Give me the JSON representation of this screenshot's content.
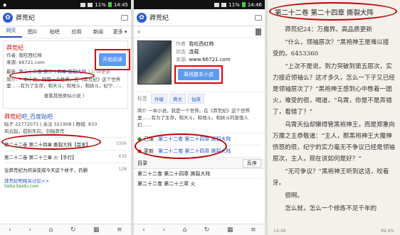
{
  "p1": {
    "status": {
      "left": "◆",
      "time": "14:45",
      "battery": "11%"
    },
    "search": {
      "query": "莽荒纪"
    },
    "tabs": [
      "网页",
      "图片",
      "贴吧",
      "应用",
      "新闻",
      "更多 ▾"
    ],
    "result": {
      "title": "莽荒纪",
      "author": "作者: 我吃西红柿",
      "source": "来源: 66721.com",
      "latest_prefix": "最新:",
      "latest_link": "第二十二卷 第二十四章 撕裂大阵",
      "latest_time": "12:38更新",
      "desc": "简介: 一本小说，就是一个世界。在《莽荒纪》这个世界里……有为了生存，和天斗，和地斗，和妖斗，纪宁……",
      "open_button": "开始阅读",
      "more": "查看其他类似小说 〉"
    },
    "tieba": {
      "title_a": "莽荒纪",
      "title_b": "吧_百度贴吧",
      "stats": "贴子 22772073 | 关注 321908 | 群组: 833",
      "desc": "风云起，搅别东向，剑指莽荒"
    },
    "posts": [
      {
        "title": "第二十二卷 第二十四章 撕裂大阵【首发】",
        "count": "3306"
      },
      {
        "title": "第二十二卷 第二十三章 火【手打】",
        "count": "639"
      },
      {
        "title": "论莽荒纪为何演变成今天这个样子，仍删",
        "count": "128"
      }
    ],
    "more_link": "莽荒纪吧相关讨论>>",
    "more_src": "tieba.baidu.com",
    "nav": [
      "‹",
      "›",
      "⌂",
      "↻",
      "▦",
      "≡"
    ]
  },
  "p2": {
    "status": {
      "time": "14:46",
      "battery": "11%"
    },
    "search": {
      "query": "莽荒纪"
    },
    "header_back": "‹",
    "book": {
      "author_label": "作者",
      "author": "我吃西红柿",
      "state_label": "状态",
      "state": "连载",
      "source_label": "来源",
      "source": "www.66721.com",
      "download_button": "离线整本小说"
    },
    "tags_label": "标签",
    "tags": [
      "升级",
      "爽文",
      "仙侠"
    ],
    "intro": "简介  一本小说，就是一个世界。在《莽荒纪》这个世界里……有为了生存，和天斗，和地斗，和妖斗的部落人们……",
    "actions": [
      {
        "label": "已读",
        "value": "第二十二卷 第二十四章 撕裂大阵"
      },
      {
        "label": "更新",
        "value": "第二十二卷 第二十四章 撕裂大阵"
      }
    ],
    "toc": {
      "label": "目录",
      "sort": "反序"
    },
    "chapters": [
      "第二十二卷 第二十四章 撕裂大阵",
      "第二十二卷 第二十三章 火"
    ],
    "nav": [
      "‹",
      "›",
      "⌂",
      "↻",
      "▦",
      "≡"
    ]
  },
  "p3": {
    "title": "第二十二卷 第二十四章 撕裂大阵",
    "subtitle": "莽荒纪24：万魔界。高品质更新",
    "paragraphs": [
      "“什么，领袖层次？”黑袍神王是难以接受的。6453360",
      "“上次不是说，到力突破到第五层次，实力接近领袖么？这才多久，怎么一下子又已经是领袖层次了？”黑袍神王感到心中憋着一团火，难受的很，喝道，“乌霄，你是不是弄错了，看错了？”",
      "乌霄天仙却懒得管黑袍神王，而是郑重向万魔之主恭敬道：“主人，那黑袍神王大魔神愤怒的很，纪宁的实力毫无不争议已经是领袖层次，主人，现在该如何是好？”",
      "“无可争议？”黑袍神王听到这话，咬着牙。",
      "很啊。",
      "怎么就，怎么一个修炼不足千年的"
    ],
    "footer_left": "14:48",
    "footer_right": "99.9%"
  }
}
